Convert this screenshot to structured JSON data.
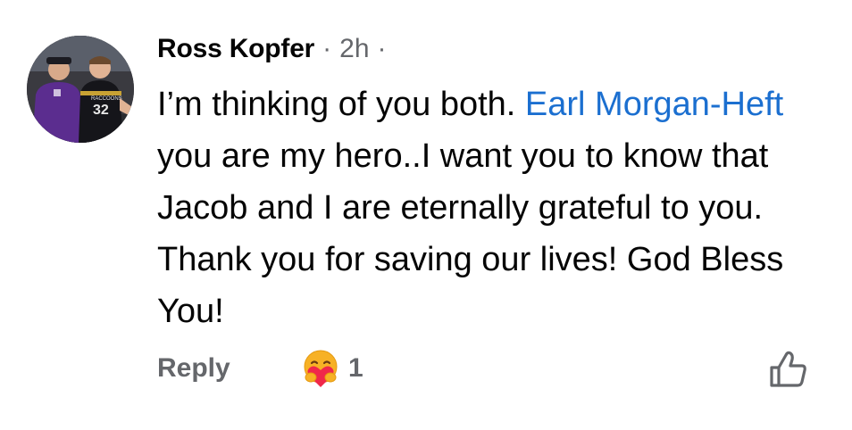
{
  "comment": {
    "author": "Ross Kopfer",
    "separator": "·",
    "time": "2h",
    "text_before": "I’m thinking of you both. ",
    "mention": "Earl Morgan-Heft",
    "text_after": " you are my hero..I want you to know that Jacob and I are eternally grateful to you. Thank you for saving our lives! God Bless You!",
    "avatar_icon": "profile-photo",
    "avatar_jersey_number": "32",
    "avatar_jersey_text": "RACCOONS"
  },
  "actions": {
    "reply_label": "Reply",
    "reaction_icon": "care-reaction-icon",
    "reaction_count": "1",
    "like_icon": "thumbs-up-outline-icon"
  },
  "colors": {
    "text": "#050505",
    "secondary": "#65676b",
    "mention": "#1b6fd0",
    "care_face": "#f7b125",
    "care_heart": "#f0284a"
  }
}
